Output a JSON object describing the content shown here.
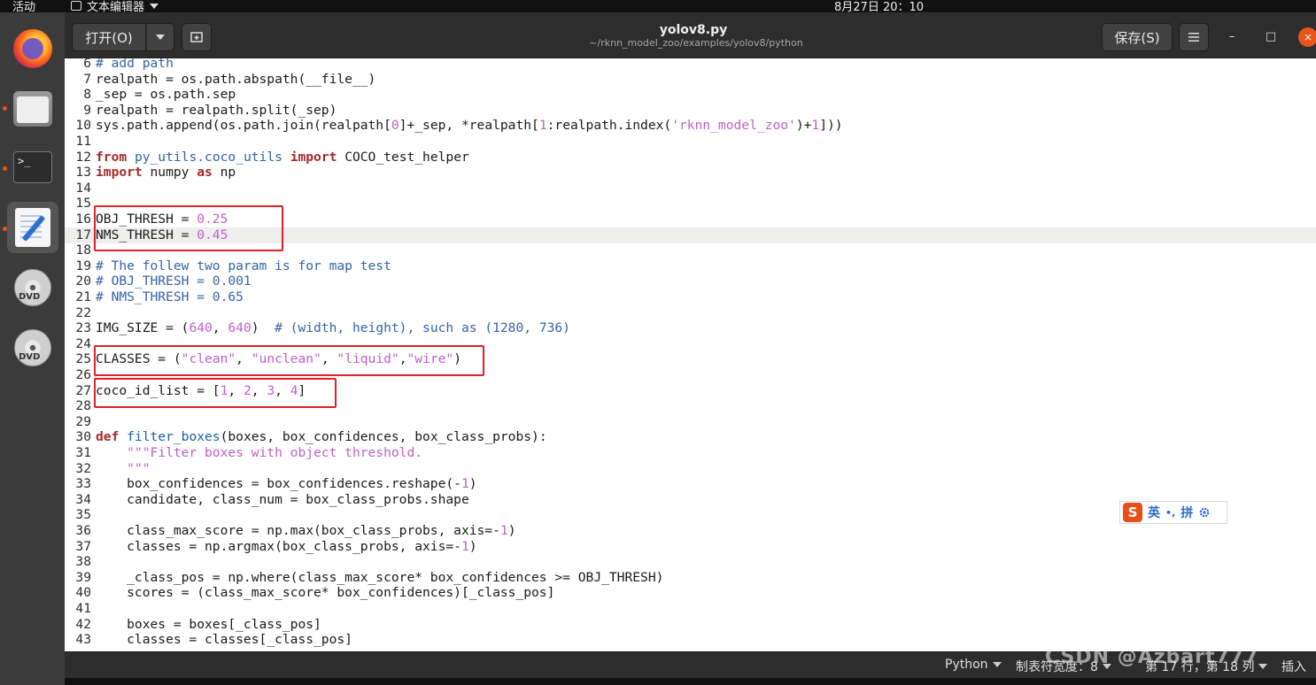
{
  "topbar": {
    "activities": "活动",
    "app_name": "文本编辑器",
    "clock": "8月27日 20：10"
  },
  "header": {
    "open_label": "打开(O)",
    "title": "yolov8.py",
    "subtitle": "~/rknn_model_zoo/examples/yolov8/python",
    "save_label": "保存(S)",
    "menu_icon": "hamburger-icon",
    "minimize": "–",
    "maximize": "□",
    "close": "×"
  },
  "editor": {
    "current_line": 17,
    "lines": [
      {
        "n": "6",
        "code": "# add path"
      },
      {
        "n": "7",
        "code": "realpath = os.path.abspath(__file__)"
      },
      {
        "n": "8",
        "code": "_sep = os.path.sep"
      },
      {
        "n": "9",
        "code": "realpath = realpath.split(_sep)"
      },
      {
        "n": "10",
        "code": "sys.path.append(os.path.join(realpath[0]+_sep, *realpath[1:realpath.index('rknn_model_zoo')+1]))"
      },
      {
        "n": "11",
        "code": ""
      },
      {
        "n": "12",
        "code": "from py_utils.coco_utils import COCO_test_helper"
      },
      {
        "n": "13",
        "code": "import numpy as np"
      },
      {
        "n": "14",
        "code": ""
      },
      {
        "n": "15",
        "code": ""
      },
      {
        "n": "16",
        "code": "OBJ_THRESH = 0.25"
      },
      {
        "n": "17",
        "code": "NMS_THRESH = 0.45"
      },
      {
        "n": "18",
        "code": ""
      },
      {
        "n": "19",
        "code": "# The follew two param is for map test"
      },
      {
        "n": "20",
        "code": "# OBJ_THRESH = 0.001"
      },
      {
        "n": "21",
        "code": "# NMS_THRESH = 0.65"
      },
      {
        "n": "22",
        "code": ""
      },
      {
        "n": "23",
        "code": "IMG_SIZE = (640, 640)  # (width, height), such as (1280, 736)"
      },
      {
        "n": "24",
        "code": ""
      },
      {
        "n": "25",
        "code": "CLASSES = (\"clean\", \"unclean\", \"liquid\",\"wire\")"
      },
      {
        "n": "26",
        "code": ""
      },
      {
        "n": "27",
        "code": "coco_id_list = [1, 2, 3, 4]"
      },
      {
        "n": "28",
        "code": ""
      },
      {
        "n": "29",
        "code": ""
      },
      {
        "n": "30",
        "code": "def filter_boxes(boxes, box_confidences, box_class_probs):"
      },
      {
        "n": "31",
        "code": "    \"\"\"Filter boxes with object threshold."
      },
      {
        "n": "32",
        "code": "    \"\"\""
      },
      {
        "n": "33",
        "code": "    box_confidences = box_confidences.reshape(-1)"
      },
      {
        "n": "34",
        "code": "    candidate, class_num = box_class_probs.shape"
      },
      {
        "n": "35",
        "code": ""
      },
      {
        "n": "36",
        "code": "    class_max_score = np.max(box_class_probs, axis=-1)"
      },
      {
        "n": "37",
        "code": "    classes = np.argmax(box_class_probs, axis=-1)"
      },
      {
        "n": "38",
        "code": ""
      },
      {
        "n": "39",
        "code": "    _class_pos = np.where(class_max_score* box_confidences >= OBJ_THRESH)"
      },
      {
        "n": "40",
        "code": "    scores = (class_max_score* box_confidences)[_class_pos]"
      },
      {
        "n": "41",
        "code": ""
      },
      {
        "n": "42",
        "code": "    boxes = boxes[_class_pos]"
      },
      {
        "n": "43",
        "code": "    classes = classes[_class_pos]"
      }
    ]
  },
  "ime": {
    "logo": "S",
    "lang": "英",
    "punct": "•,",
    "mode": "拼",
    "settings_icon": "gear-icon"
  },
  "statusbar": {
    "language": "Python",
    "tab_width": "制表符宽度：8",
    "position": "第 17 行，第 18 列",
    "insert_mode": "插入"
  },
  "watermark": "CSDN @Azbart777"
}
